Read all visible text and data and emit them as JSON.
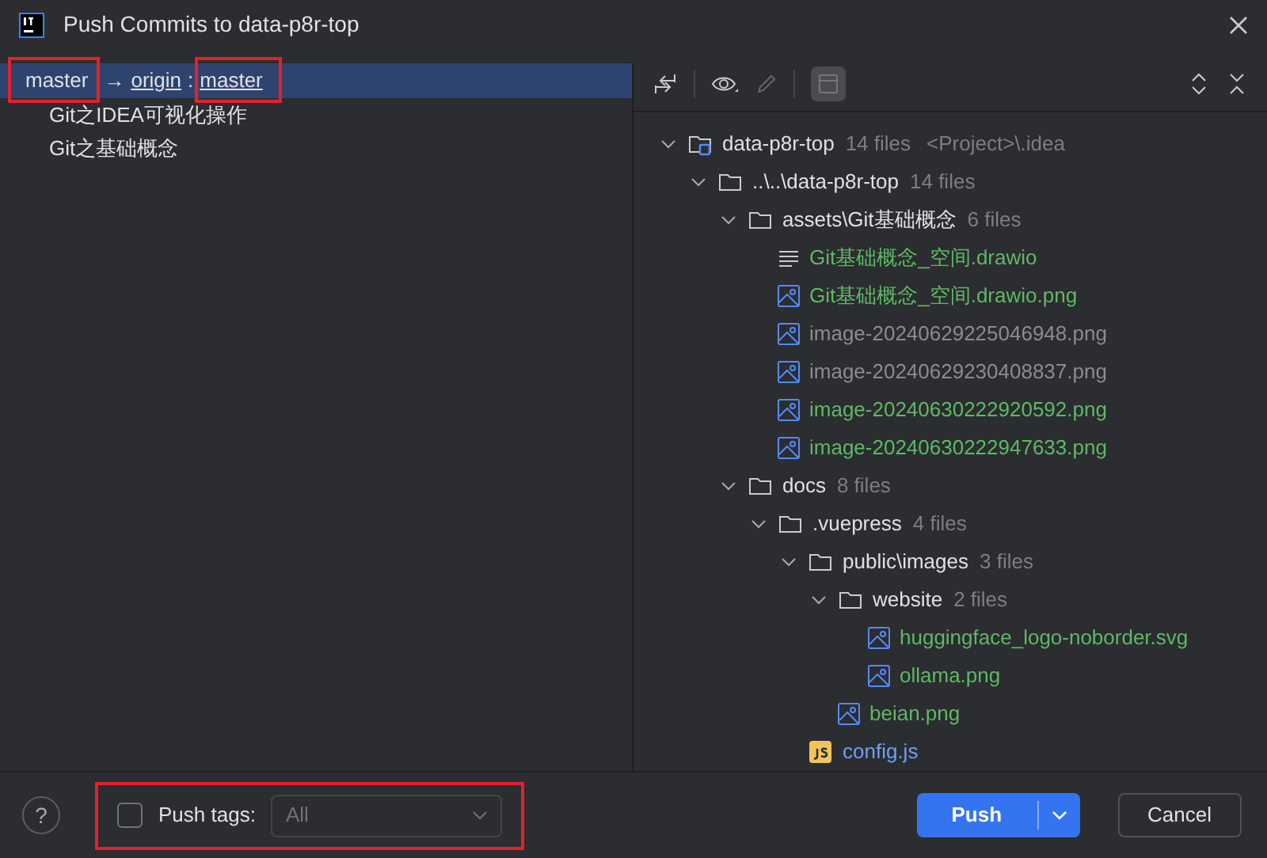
{
  "window": {
    "title": "Push Commits to data-p8r-top"
  },
  "commits": {
    "branch": {
      "local": "master",
      "arrow": "→",
      "remote": "origin",
      "separator": ":",
      "remote_branch": "master",
      "selected": true
    },
    "items": [
      {
        "label": "Git之IDEA可视化操作",
        "selected": false
      },
      {
        "label": "Git之基础概念",
        "selected": false
      }
    ]
  },
  "tree": [
    {
      "kind": "project",
      "name": "data-p8r-top",
      "count": "14 files",
      "note": "<Project>\\.idea",
      "expanded": true,
      "children": [
        {
          "kind": "folder",
          "name": "..\\..\\data-p8r-top",
          "count": "14 files",
          "expanded": true,
          "children": [
            {
              "kind": "folder",
              "name": "assets\\Git基础概念",
              "count": "6 files",
              "expanded": true,
              "children": [
                {
                  "kind": "text",
                  "name": "Git基础概念_空间.drawio",
                  "color": "#5fb865"
                },
                {
                  "kind": "image",
                  "name": "Git基础概念_空间.drawio.png",
                  "color": "#5fb865"
                },
                {
                  "kind": "image",
                  "name": "image-20240629225046948.png",
                  "color": "#8c8c8c"
                },
                {
                  "kind": "image",
                  "name": "image-20240629230408837.png",
                  "color": "#8c8c8c"
                },
                {
                  "kind": "image",
                  "name": "image-20240630222920592.png",
                  "color": "#5fb865"
                },
                {
                  "kind": "image",
                  "name": "image-20240630222947633.png",
                  "color": "#5fb865"
                }
              ]
            },
            {
              "kind": "folder",
              "name": "docs",
              "count": "8 files",
              "expanded": true,
              "children": [
                {
                  "kind": "folder",
                  "name": ".vuepress",
                  "count": "4 files",
                  "expanded": true,
                  "children": [
                    {
                      "kind": "folder",
                      "name": "public\\images",
                      "count": "3 files",
                      "expanded": true,
                      "children": [
                        {
                          "kind": "folder",
                          "name": "website",
                          "count": "2 files",
                          "expanded": true,
                          "children": [
                            {
                              "kind": "image",
                              "name": "huggingface_logo-noborder.svg",
                              "color": "#5fb865"
                            },
                            {
                              "kind": "image",
                              "name": "ollama.png",
                              "color": "#5fb865"
                            }
                          ]
                        },
                        {
                          "kind": "image",
                          "name": "beian.png",
                          "color": "#5fb865"
                        }
                      ]
                    },
                    {
                      "kind": "js",
                      "name": "config.js",
                      "color": "#6f9ff5"
                    }
                  ]
                }
              ]
            }
          ]
        }
      ]
    }
  ],
  "footer": {
    "help": "?",
    "push_tags": {
      "label": "Push tags:",
      "checked": false
    },
    "tags_dropdown": {
      "value": "All",
      "disabled": true
    },
    "buttons": [
      {
        "kind": "primary",
        "label": "Push"
      },
      {
        "kind": "secondary",
        "label": "Cancel"
      }
    ]
  }
}
